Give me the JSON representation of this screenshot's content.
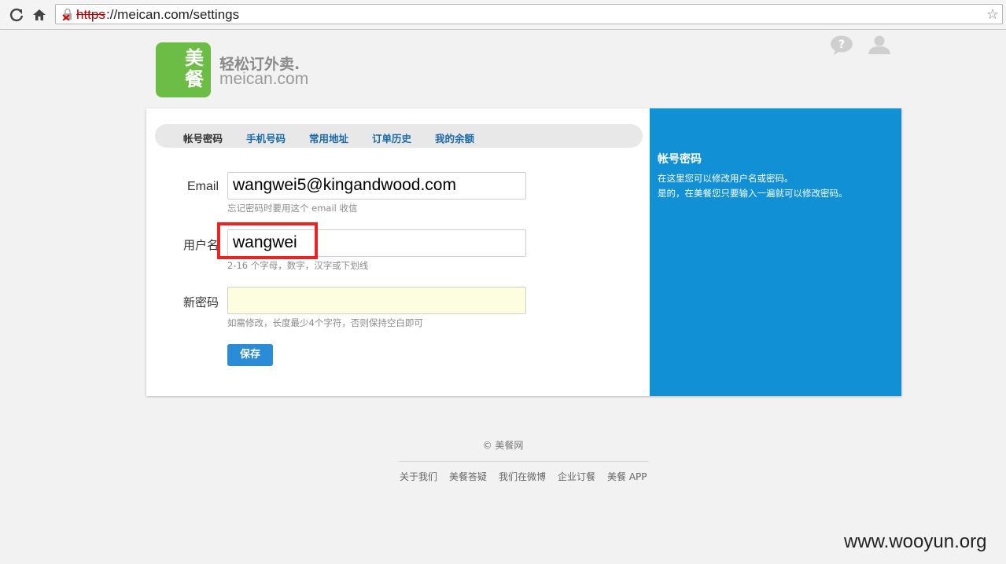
{
  "browser": {
    "url_scheme": "https",
    "url_rest": "://meican.com/settings",
    "star_glyph": "☆"
  },
  "header": {
    "logo_chars": [
      "美",
      "餐"
    ],
    "slogan": "轻松订外卖.",
    "domain": "meican.com",
    "icons": [
      "help-icon",
      "user-icon"
    ]
  },
  "tabs": [
    {
      "label": "帐号密码",
      "active": true
    },
    {
      "label": "手机号码",
      "active": false
    },
    {
      "label": "常用地址",
      "active": false
    },
    {
      "label": "订单历史",
      "active": false
    },
    {
      "label": "我的余额",
      "active": false
    }
  ],
  "form": {
    "email": {
      "label": "Email",
      "value": "wangwei5@kingandwood.com",
      "hint": "忘记密码时要用这个 email 收信"
    },
    "username": {
      "label": "用户名",
      "value": "wangwei",
      "hint": "2-16 个字母，数字，汉字或下划线"
    },
    "password": {
      "label": "新密码",
      "value": "",
      "hint": "如需修改，长度最少4个字符，否则保持空白即可"
    },
    "save_label": "保存"
  },
  "side_panel": {
    "title": "帐号密码",
    "lines": [
      "在这里您可以修改用户名或密码。",
      "是的，在美餐您只要输入一遍就可以修改密码。"
    ]
  },
  "footer": {
    "copyright": "© 美餐网",
    "links": [
      "关于我们",
      "美餐答疑",
      "我们在微博",
      "企业订餐",
      "美餐 APP"
    ]
  },
  "watermark": "www.wooyun.org",
  "colors": {
    "brand_green": "#6cbd45",
    "panel_blue": "#1190d6",
    "highlight_red": "#ee2222"
  }
}
